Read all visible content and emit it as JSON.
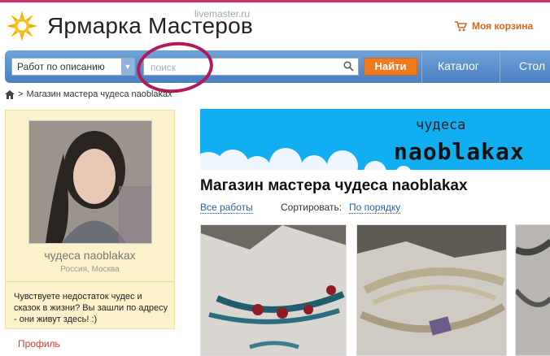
{
  "header": {
    "brand": "Ярмарка Мастеров",
    "domain": "livemaster.ru",
    "cart_label": "Моя корзина"
  },
  "nav": {
    "filter_value": "Работ по описанию",
    "search_placeholder": "поиск",
    "search_button": "Найти",
    "catalog": "Каталог",
    "stol": "Стол"
  },
  "breadcrumb": {
    "separator": ">",
    "current": "Магазин мастера чудеса naoblakax"
  },
  "sidebar": {
    "name": "чудеса naoblakax",
    "location": "Россия, Москва",
    "promo": "Чувствуете недостаток чудес и сказок в жизни? Вы зашли по адресу - они живут здесь! :)",
    "profile_link": "Профиль"
  },
  "banner": {
    "line1": "чудеса",
    "line2": "naoblakax"
  },
  "main": {
    "title": "Магазин мастера чудеса naoblakax",
    "all_works": "Все работы",
    "sort_label": "Сортировать:",
    "sort_value": "По порядку"
  },
  "colors": {
    "accent_orange": "#f07a20",
    "nav_blue": "#4a7fc0",
    "banner_blue": "#12aef2",
    "annotation_circle": "#b0195a"
  }
}
